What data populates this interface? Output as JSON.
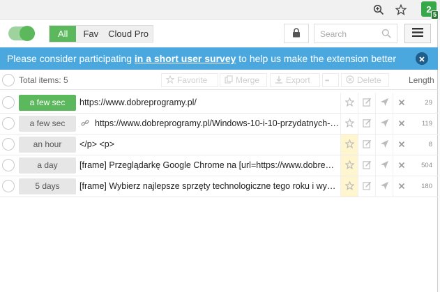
{
  "browser": {
    "icons": [
      "zoom-icon",
      "star-icon"
    ],
    "extension": {
      "letter": "2",
      "badge": "5"
    }
  },
  "toolbar": {
    "toggle_on": true,
    "tabs": [
      {
        "label": "All",
        "active": true
      },
      {
        "label": "Fav",
        "active": false
      },
      {
        "label": "Cloud Pro",
        "active": false
      }
    ],
    "search_placeholder": "Search"
  },
  "banner": {
    "text_before": "Please consider participating ",
    "link_text": "in a short user survey",
    "text_after": " to help us make the extension better"
  },
  "actions": {
    "total": "Total items: 5",
    "favorite": "Favorite",
    "merge": "Merge",
    "export": "Export",
    "more": "•••",
    "delete": "Delete",
    "length": "Length"
  },
  "items": [
    {
      "time": "a few sec",
      "text": "https://www.dobreprogramy.pl/",
      "length": "29",
      "highlight": true,
      "is_link": false,
      "fav": false
    },
    {
      "time": "a few sec",
      "text": "https://www.dobreprogramy.pl/Windows-10-i-10-przydatnych-s...",
      "length": "119",
      "highlight": false,
      "is_link": true,
      "fav": false
    },
    {
      "time": "an hour",
      "text": "</p> <p>",
      "length": "8",
      "highlight": false,
      "is_link": false,
      "fav": true
    },
    {
      "time": "a day",
      "text": "[frame] Przeglądarkę Google Chrome na [url=https://www.dobrepro...",
      "length": "504",
      "highlight": false,
      "is_link": false,
      "fav": true
    },
    {
      "time": "5 days",
      "text": "[frame] Wybierz najlepsze sprzęty technologiczne tego roku i wygraj ...",
      "length": "180",
      "highlight": false,
      "is_link": false,
      "fav": true
    }
  ],
  "colors": {
    "accent": "#5cb85c",
    "banner": "#4aa8de",
    "fav_highlight": "#fff6d0"
  }
}
